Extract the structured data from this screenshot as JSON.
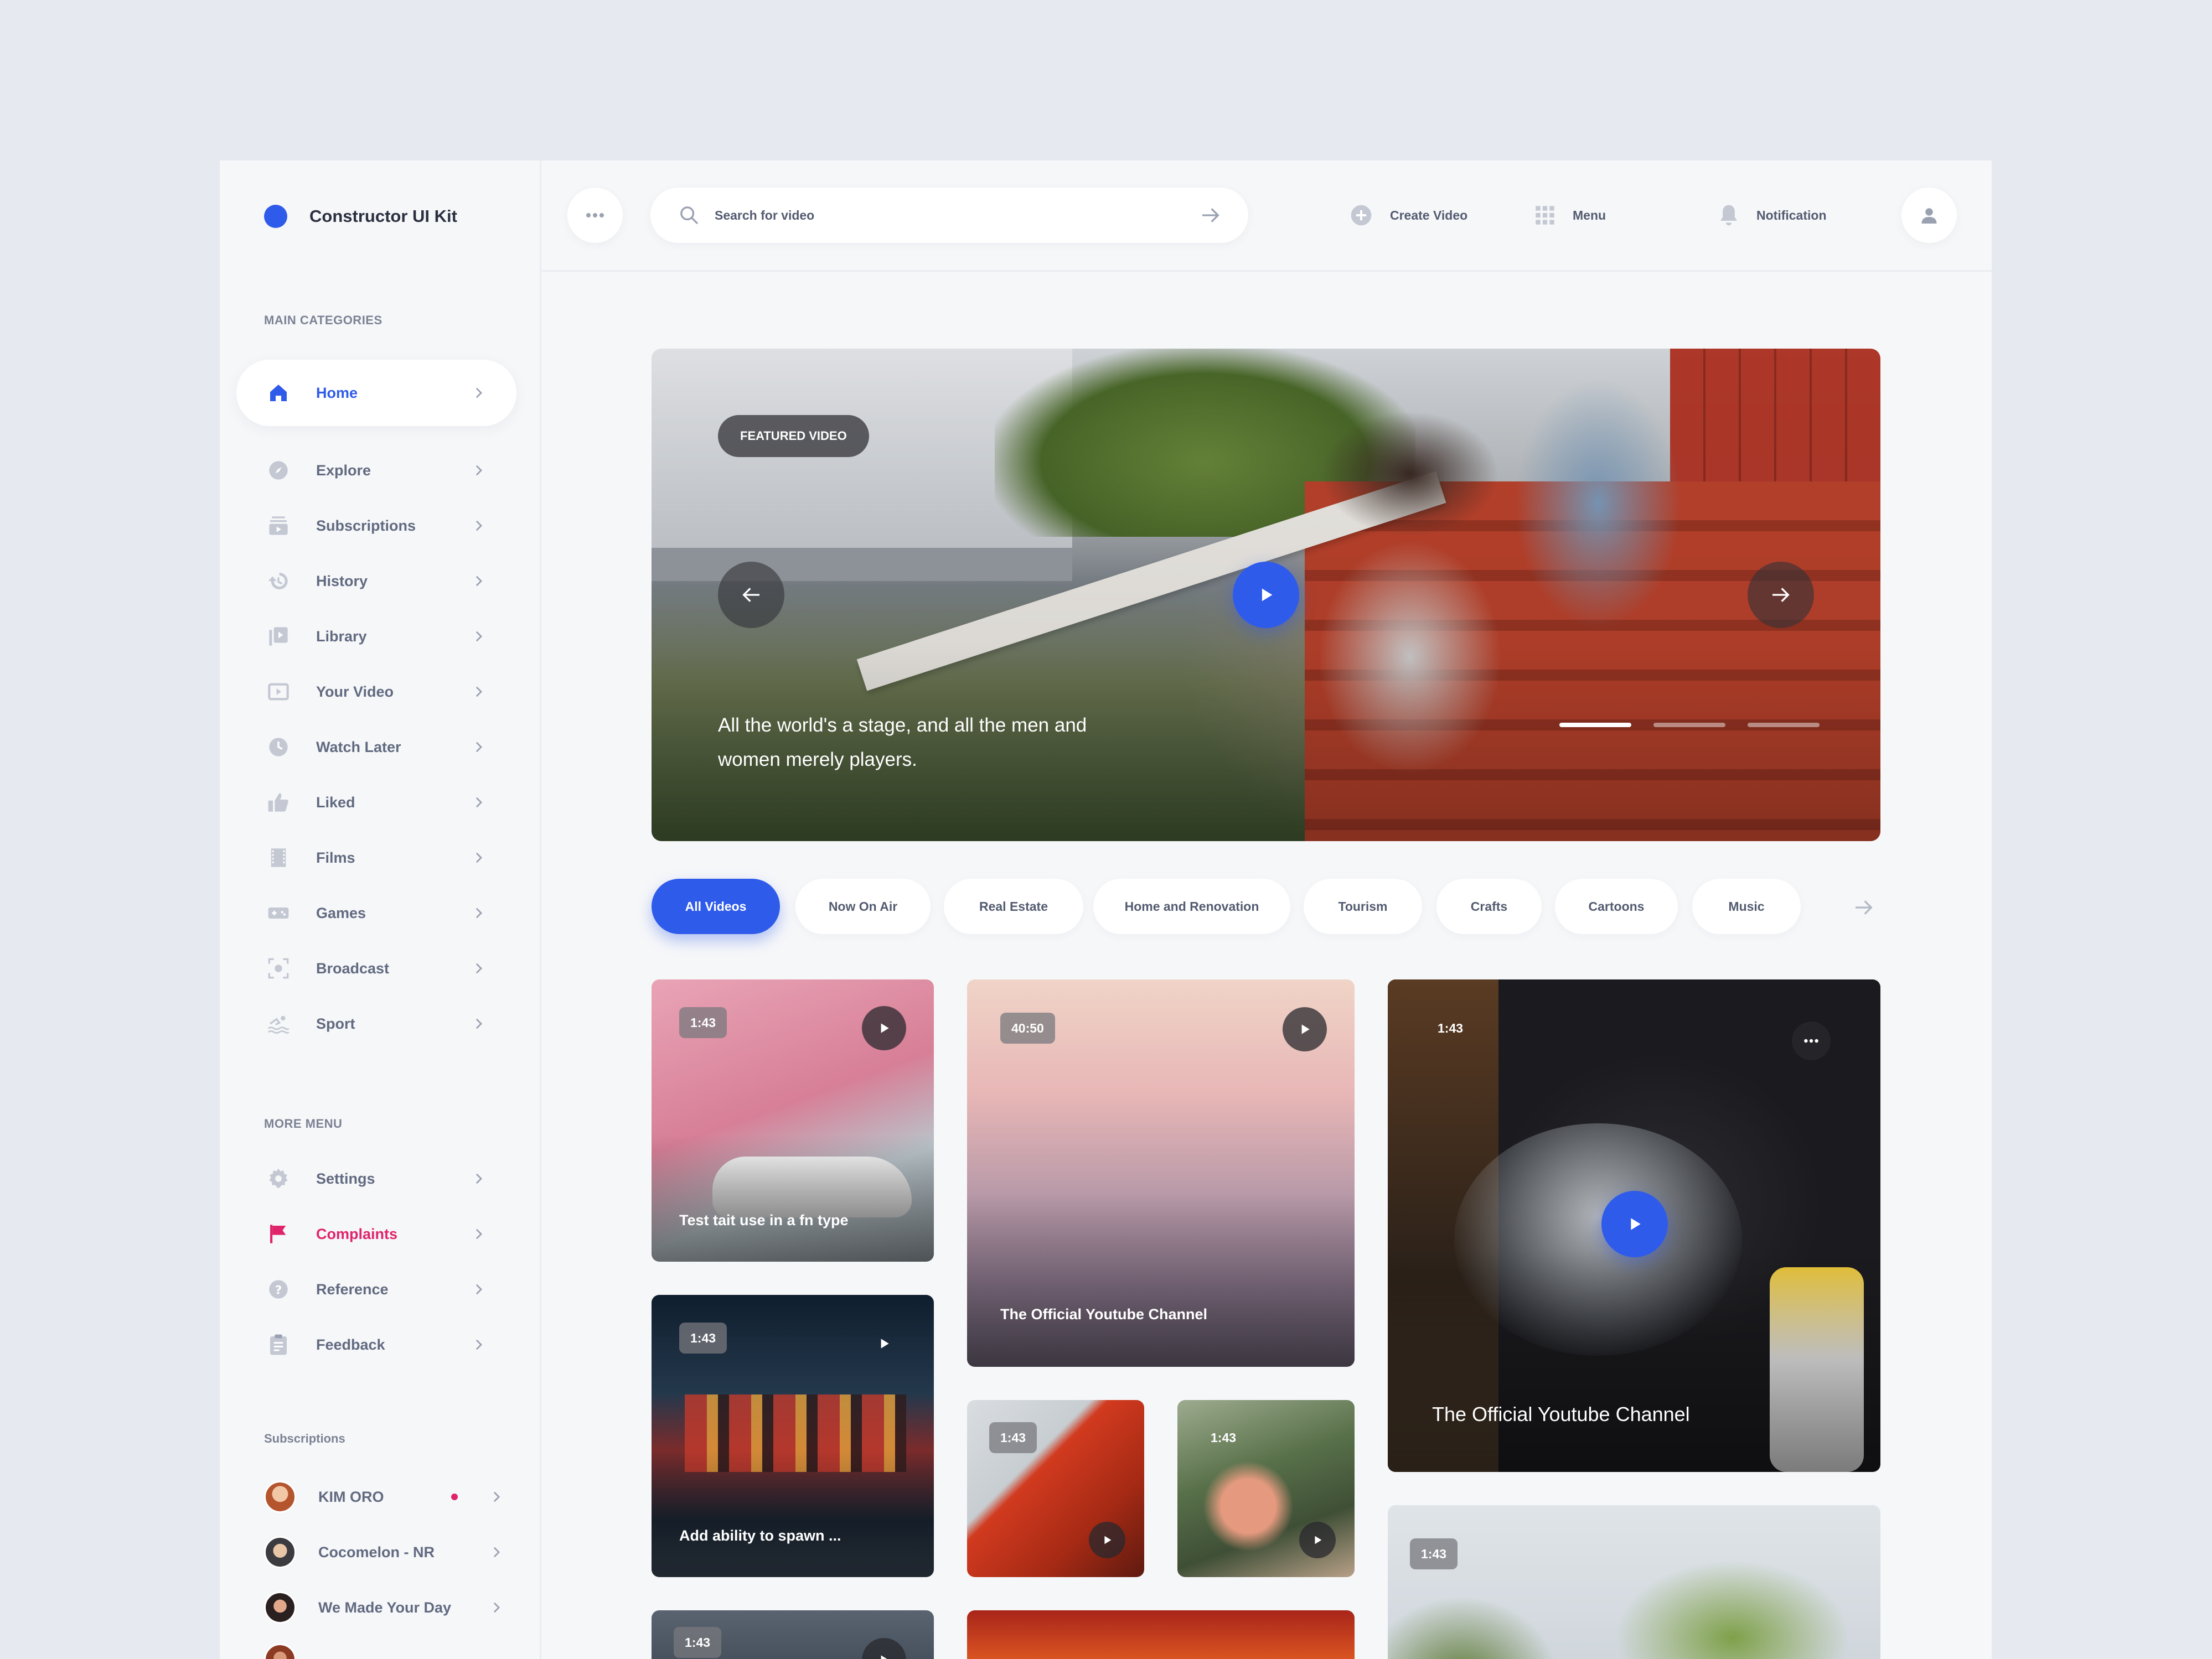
{
  "brand": {
    "name": "Constructor UI Kit",
    "color": "#2f5bea"
  },
  "sidebar": {
    "main_label": "MAIN CATEGORIES",
    "items": [
      {
        "label": "Home",
        "icon": "home-icon",
        "active": true
      },
      {
        "label": "Explore",
        "icon": "compass-icon"
      },
      {
        "label": "Subscriptions",
        "icon": "subscriptions-icon"
      },
      {
        "label": "History",
        "icon": "history-icon"
      },
      {
        "label": "Library",
        "icon": "library-icon"
      },
      {
        "label": "Your Video",
        "icon": "video-icon"
      },
      {
        "label": "Watch Later",
        "icon": "clock-icon"
      },
      {
        "label": "Liked",
        "icon": "thumbs-up-icon"
      },
      {
        "label": "Films",
        "icon": "film-icon"
      },
      {
        "label": "Games",
        "icon": "gamepad-icon"
      },
      {
        "label": "Broadcast",
        "icon": "broadcast-icon"
      },
      {
        "label": "Sport",
        "icon": "swim-icon"
      }
    ],
    "more_label": "MORE MENU",
    "more_items": [
      {
        "label": "Settings",
        "icon": "gear-icon"
      },
      {
        "label": "Complaints",
        "icon": "flag-icon",
        "alert": true
      },
      {
        "label": "Reference",
        "icon": "help-icon"
      },
      {
        "label": "Feedback",
        "icon": "clipboard-icon"
      }
    ],
    "subs_label": "Subscriptions",
    "subscriptions": [
      {
        "name": "KIM ORO",
        "new": true
      },
      {
        "name": "Cocomelon - NR"
      },
      {
        "name": "We Made Your Day"
      }
    ]
  },
  "topbar": {
    "search_placeholder": "Search for video",
    "create_label": "Create Video",
    "menu_label": "Menu",
    "notification_label": "Notification"
  },
  "hero": {
    "badge": "FEATURED VIDEO",
    "caption": "All the world's a stage, and all the men and women merely players.",
    "slides": 3,
    "active_slide": 1
  },
  "categories": [
    "All Videos",
    "Now On Air",
    "Real Estate",
    "Home and Renovation",
    "Tourism",
    "Crafts",
    "Cartoons",
    "Music"
  ],
  "videos": [
    {
      "duration": "1:43",
      "title": "Test tait use in a fn type"
    },
    {
      "duration": "40:50",
      "title": "The Official Youtube Channel"
    },
    {
      "duration": "1:43",
      "title": "The Official Youtube Channel"
    },
    {
      "duration": "1:43",
      "title": "Add ability to spawn ..."
    },
    {
      "duration": "1:43",
      "title": ""
    },
    {
      "duration": "1:43",
      "title": ""
    },
    {
      "duration": "1:43",
      "title": ""
    },
    {
      "duration": "1:43",
      "title": ""
    }
  ],
  "colors": {
    "accent": "#2f5bea",
    "alert": "#e0246b",
    "background": "#f6f7f9"
  }
}
